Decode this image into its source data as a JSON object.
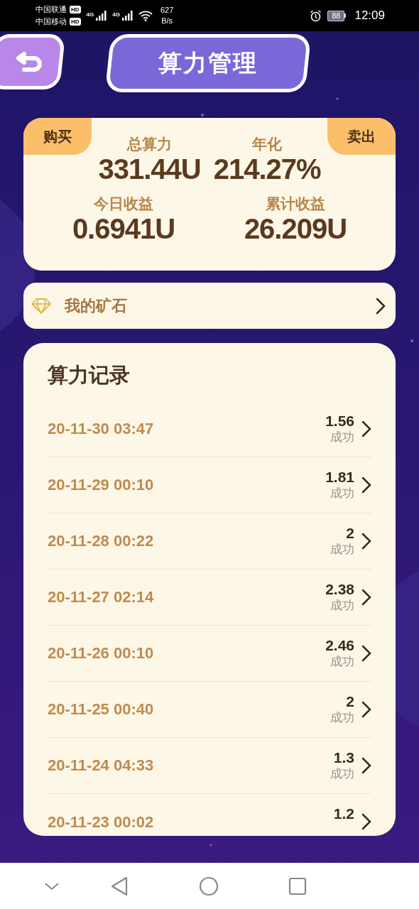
{
  "status_bar": {
    "carrier_1": "中国联通",
    "carrier_2": "中国移动",
    "hd_1": "HD",
    "hd_2": "HD",
    "net_1": "4G",
    "net_2": "4G",
    "speed": "627",
    "speed_unit": "B/s",
    "battery": "88",
    "time": "12:09"
  },
  "header": {
    "title": "算力管理"
  },
  "summary": {
    "buy": "购买",
    "sell": "卖出",
    "stats": [
      {
        "label": "总算力",
        "value": "331.44U"
      },
      {
        "label": "年化",
        "value": "214.27%"
      },
      {
        "label": "今日收益",
        "value": "0.6941U"
      },
      {
        "label": "累计收益",
        "value": "26.209U"
      }
    ]
  },
  "ore": {
    "label": "我的矿石"
  },
  "records": {
    "title": "算力记录",
    "rows": [
      {
        "time": "20-11-30 03:47",
        "amount": "1.56",
        "status": "成功"
      },
      {
        "time": "20-11-29 00:10",
        "amount": "1.81",
        "status": "成功"
      },
      {
        "time": "20-11-28 00:22",
        "amount": "2",
        "status": "成功"
      },
      {
        "time": "20-11-27 02:14",
        "amount": "2.38",
        "status": "成功"
      },
      {
        "time": "20-11-26 00:10",
        "amount": "2.46",
        "status": "成功"
      },
      {
        "time": "20-11-25 00:40",
        "amount": "2",
        "status": "成功"
      },
      {
        "time": "20-11-24 04:33",
        "amount": "1.3",
        "status": "成功"
      },
      {
        "time": "20-11-23 00:02",
        "amount": "1.2"
      }
    ]
  }
}
